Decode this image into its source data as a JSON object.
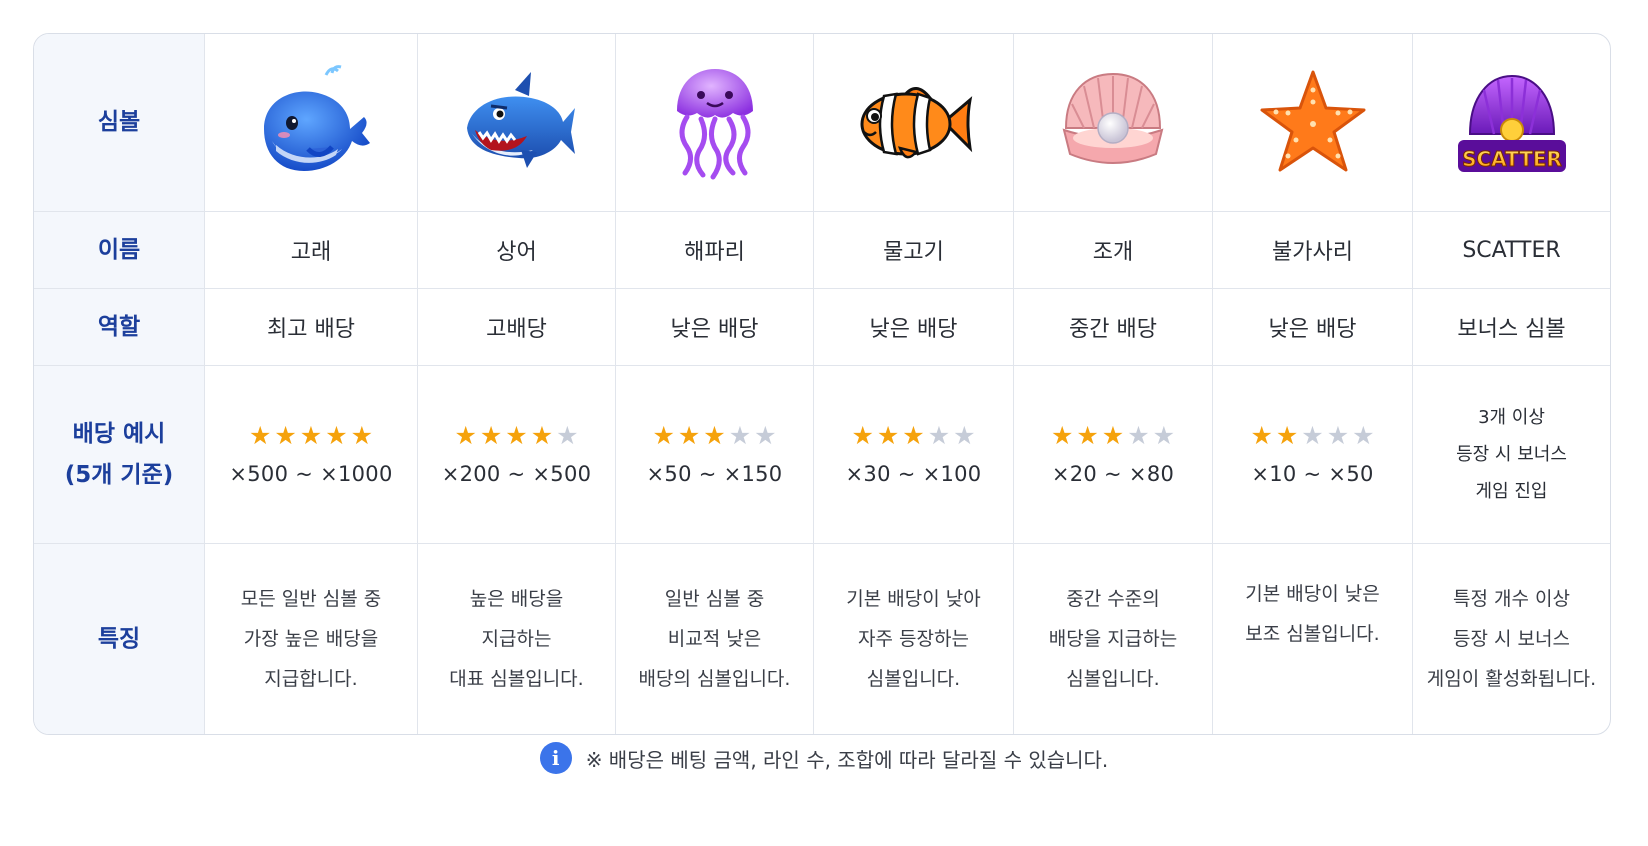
{
  "row_headers": {
    "symbol": "심볼",
    "name": "이름",
    "role": "역할",
    "payout_line1": "배당 예시",
    "payout_line2": "(5개 기준)",
    "feature": "특징"
  },
  "symbols": [
    {
      "icon": "whale-icon",
      "name": "고래",
      "role": "최고 배당",
      "stars_of_5": 5,
      "payout": "×500 ~ ×1000",
      "feature": [
        "모든 일반 심볼 중",
        "가장 높은 배당을",
        "지급합니다."
      ]
    },
    {
      "icon": "shark-icon",
      "name": "상어",
      "role": "고배당",
      "stars_of_5": 4,
      "payout": "×200 ~ ×500",
      "feature": [
        "높은 배당을",
        "지급하는",
        "대표 심볼입니다."
      ]
    },
    {
      "icon": "jellyfish-icon",
      "name": "해파리",
      "role": "낮은 배당",
      "stars_of_5": 3,
      "payout": "×50 ~ ×150",
      "feature": [
        "일반 심볼 중",
        "비교적 낮은",
        "배당의 심볼입니다."
      ]
    },
    {
      "icon": "clownfish-icon",
      "name": "물고기",
      "role": "낮은 배당",
      "stars_of_5": 3,
      "payout": "×30 ~ ×100",
      "feature": [
        "기본 배당이 낮아",
        "자주 등장하는",
        "심볼입니다."
      ]
    },
    {
      "icon": "clam-pearl-icon",
      "name": "조개",
      "role": "중간 배당",
      "stars_of_5": 3,
      "payout": "×20 ~ ×80",
      "feature": [
        "중간 수준의",
        "배당을 지급하는",
        "심볼입니다."
      ]
    },
    {
      "icon": "starfish-icon",
      "name": "불가사리",
      "role": "낮은 배당",
      "stars_of_5": 2,
      "payout": "×10 ~ ×50",
      "feature": [
        "기본 배당이 낮은",
        "보조 심볼입니다."
      ]
    },
    {
      "icon": "scatter-shell-icon",
      "icon_text": "SCATTER",
      "name": "SCATTER",
      "role": "보너스 심볼",
      "payout_note": [
        "3개 이상",
        "등장 시 보너스",
        "게임 진입"
      ],
      "feature": [
        "특정 개수 이상",
        "등장 시 보너스",
        "게임이 활성화됩니다."
      ]
    }
  ],
  "footer": {
    "icon": "info-icon",
    "text": "※ 배당은 베팅 금액, 라인 수, 조합에 따라 달라질 수 있습니다."
  },
  "colors": {
    "header_text": "#1c3f9c",
    "header_bg": "#f4f7fc",
    "star_on": "#f5a20c",
    "star_off": "#c6ccd8",
    "info_icon": "#3b74ea"
  }
}
